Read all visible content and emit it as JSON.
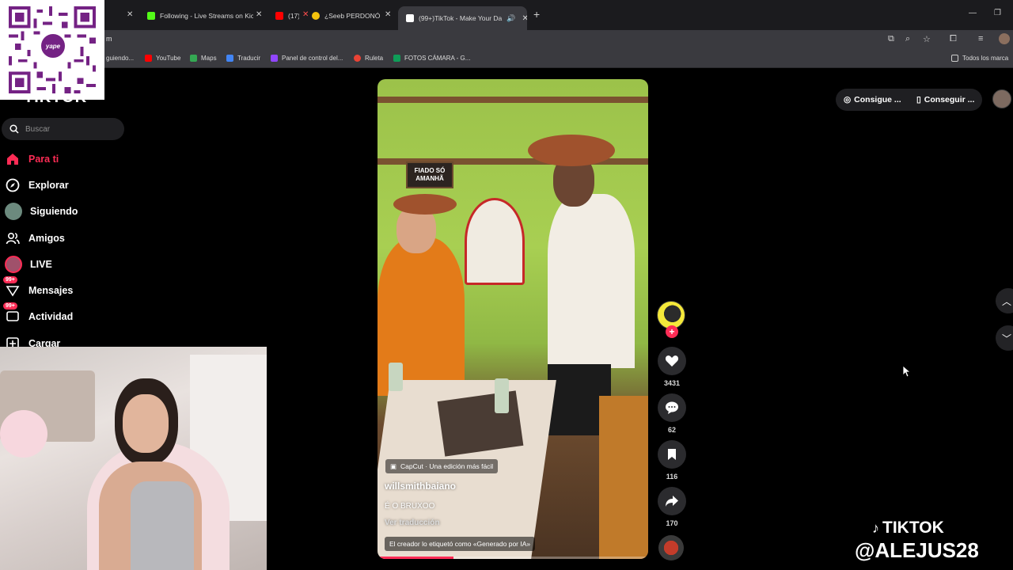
{
  "browser": {
    "tabs": [
      {
        "label": "Following - Live Streams on Kic",
        "favicon": "kick-icon",
        "color": "#53fc18"
      },
      {
        "label": "(17)",
        "favicon": "youtube-icon",
        "color": "#ff0000"
      },
      {
        "label": "¿Seeb PERDONÓ lo",
        "favicon": "chrome-icon",
        "color": "#f4c20d"
      },
      {
        "label": "(99+)TikTok - Make Your Da",
        "favicon": "tiktok-icon",
        "color": "#ffffff"
      }
    ],
    "url": "m",
    "bookmarks": [
      {
        "label": "guiendo...",
        "color": "#888888"
      },
      {
        "label": "YouTube",
        "color": "#ff0000"
      },
      {
        "label": "Maps",
        "color": "#34a853"
      },
      {
        "label": "Traducir",
        "color": "#4285f4"
      },
      {
        "label": "Panel de control del...",
        "color": "#9146ff"
      },
      {
        "label": "Ruleta",
        "color": "#ea4335"
      },
      {
        "label": "FOTOS CÁMARA - G...",
        "color": "#0f9d58"
      },
      {
        "label": "Todos los marca",
        "color": "#cccccc"
      }
    ]
  },
  "qr": {
    "brand": "yape"
  },
  "sidebar": {
    "logo_partial": "TIKTOK",
    "search_placeholder": "Buscar",
    "items": [
      {
        "label": "Para ti",
        "icon": "home-icon"
      },
      {
        "label": "Explorar",
        "icon": "compass-icon"
      },
      {
        "label": "Siguiendo",
        "icon": "avatar-icon"
      },
      {
        "label": "Amigos",
        "icon": "friends-icon"
      },
      {
        "label": "LIVE",
        "icon": "live-icon"
      },
      {
        "label": "Mensajes",
        "icon": "messages-icon",
        "badge": "99+"
      },
      {
        "label": "Actividad",
        "icon": "activity-icon",
        "badge": "99+"
      },
      {
        "label": "Cargar",
        "icon": "upload-icon"
      }
    ]
  },
  "topbar": {
    "btn1": "Consigue ...",
    "btn2": "Conseguir ..."
  },
  "video": {
    "capcut": "CapCut · Una edición más fácil",
    "username": "willsmithbaiano",
    "caption": "É O BRUXOO",
    "translate": "Ver traducción",
    "ai_label": "El creador lo etiquetó como «Generado por IA»",
    "sign": "FIADO SÓ AMANHÃ",
    "progress": 0.28
  },
  "actions": {
    "likes": "3431",
    "comments": "62",
    "saves": "116",
    "shares": "170"
  },
  "watermark": {
    "line1": "TIKTOK",
    "line2": "@ALEJUS28"
  },
  "colors": {
    "accent": "#fe2c55"
  }
}
